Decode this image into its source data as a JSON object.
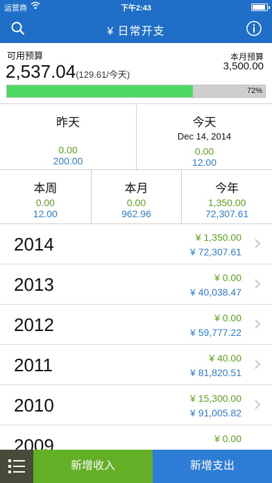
{
  "status_bar": {
    "carrier": "运营商",
    "time": "下午2:43",
    "wifi_icon": "wifi-icon",
    "battery_icon": "battery-icon"
  },
  "nav": {
    "title": "¥ 日常开支",
    "search_icon": "search-icon",
    "info_icon": "info-icon"
  },
  "budget": {
    "available_label": "可用预算",
    "available_amount": "2,537.04",
    "daily_amount": "(129.61/今天)",
    "month_label": "本月预算",
    "month_amount": "3,500.00",
    "progress_text": "72%",
    "progress_fraction": 0.72
  },
  "summary": {
    "yesterday": {
      "title": "昨天",
      "green": "0.00",
      "blue": "200.00"
    },
    "today": {
      "title": "今天",
      "date": "Dec 14, 2014",
      "green": "0.00",
      "blue": "12.00"
    },
    "week": {
      "title": "本周",
      "green": "0.00",
      "blue": "12.00"
    },
    "month": {
      "title": "本月",
      "green": "0.00",
      "blue": "962.96"
    },
    "year": {
      "title": "今年",
      "green": "1,350.00",
      "blue": "72,307.61"
    }
  },
  "years": [
    {
      "year": "2014",
      "green": "¥ 1,350.00",
      "blue": "¥ 72,307.61"
    },
    {
      "year": "2013",
      "green": "¥ 0.00",
      "blue": "¥ 40,038.47"
    },
    {
      "year": "2012",
      "green": "¥ 0.00",
      "blue": "¥ 59,777.22"
    },
    {
      "year": "2011",
      "green": "¥ 40.00",
      "blue": "¥ 81,820.51"
    },
    {
      "year": "2010",
      "green": "¥ 15,300.00",
      "blue": "¥ 91,005.82"
    },
    {
      "year": "2009",
      "green": "¥ 0.00",
      "blue": ""
    }
  ],
  "bottom": {
    "menu_icon": "list-menu-icon",
    "income_label": "新增收入",
    "expense_label": "新增支出"
  },
  "colors": {
    "header_blue": "#1f6fc9",
    "green": "#5aa31a",
    "blue": "#2d7cd6",
    "progress_green": "#4cd964",
    "income_bg": "#63b027",
    "expense_bg": "#2d7cd6",
    "menu_bg": "#4a4a3a"
  }
}
